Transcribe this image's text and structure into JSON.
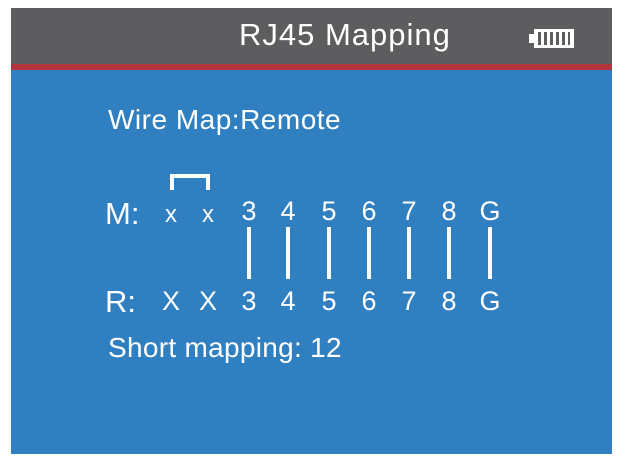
{
  "header": {
    "title": "RJ45 Mapping",
    "battery_icon": "battery-full-icon"
  },
  "wire_map": {
    "label": "Wire Map:Remote",
    "main_label": "M:",
    "remote_label": "R:",
    "main_pins": [
      "x",
      "x",
      "3",
      "4",
      "5",
      "6",
      "7",
      "8",
      "G"
    ],
    "remote_pins": [
      "X",
      "X",
      "3",
      "4",
      "5",
      "6",
      "7",
      "8",
      "G"
    ],
    "connected": [
      false,
      false,
      true,
      true,
      true,
      true,
      true,
      true,
      true
    ],
    "shorted_pairs": [
      [
        1,
        2
      ]
    ]
  },
  "summary": "Short mapping: 12",
  "colors": {
    "background": "#2f7fc1",
    "header": "#5d5d5f",
    "accent_line": "#b4333d",
    "text": "#ffffff"
  }
}
